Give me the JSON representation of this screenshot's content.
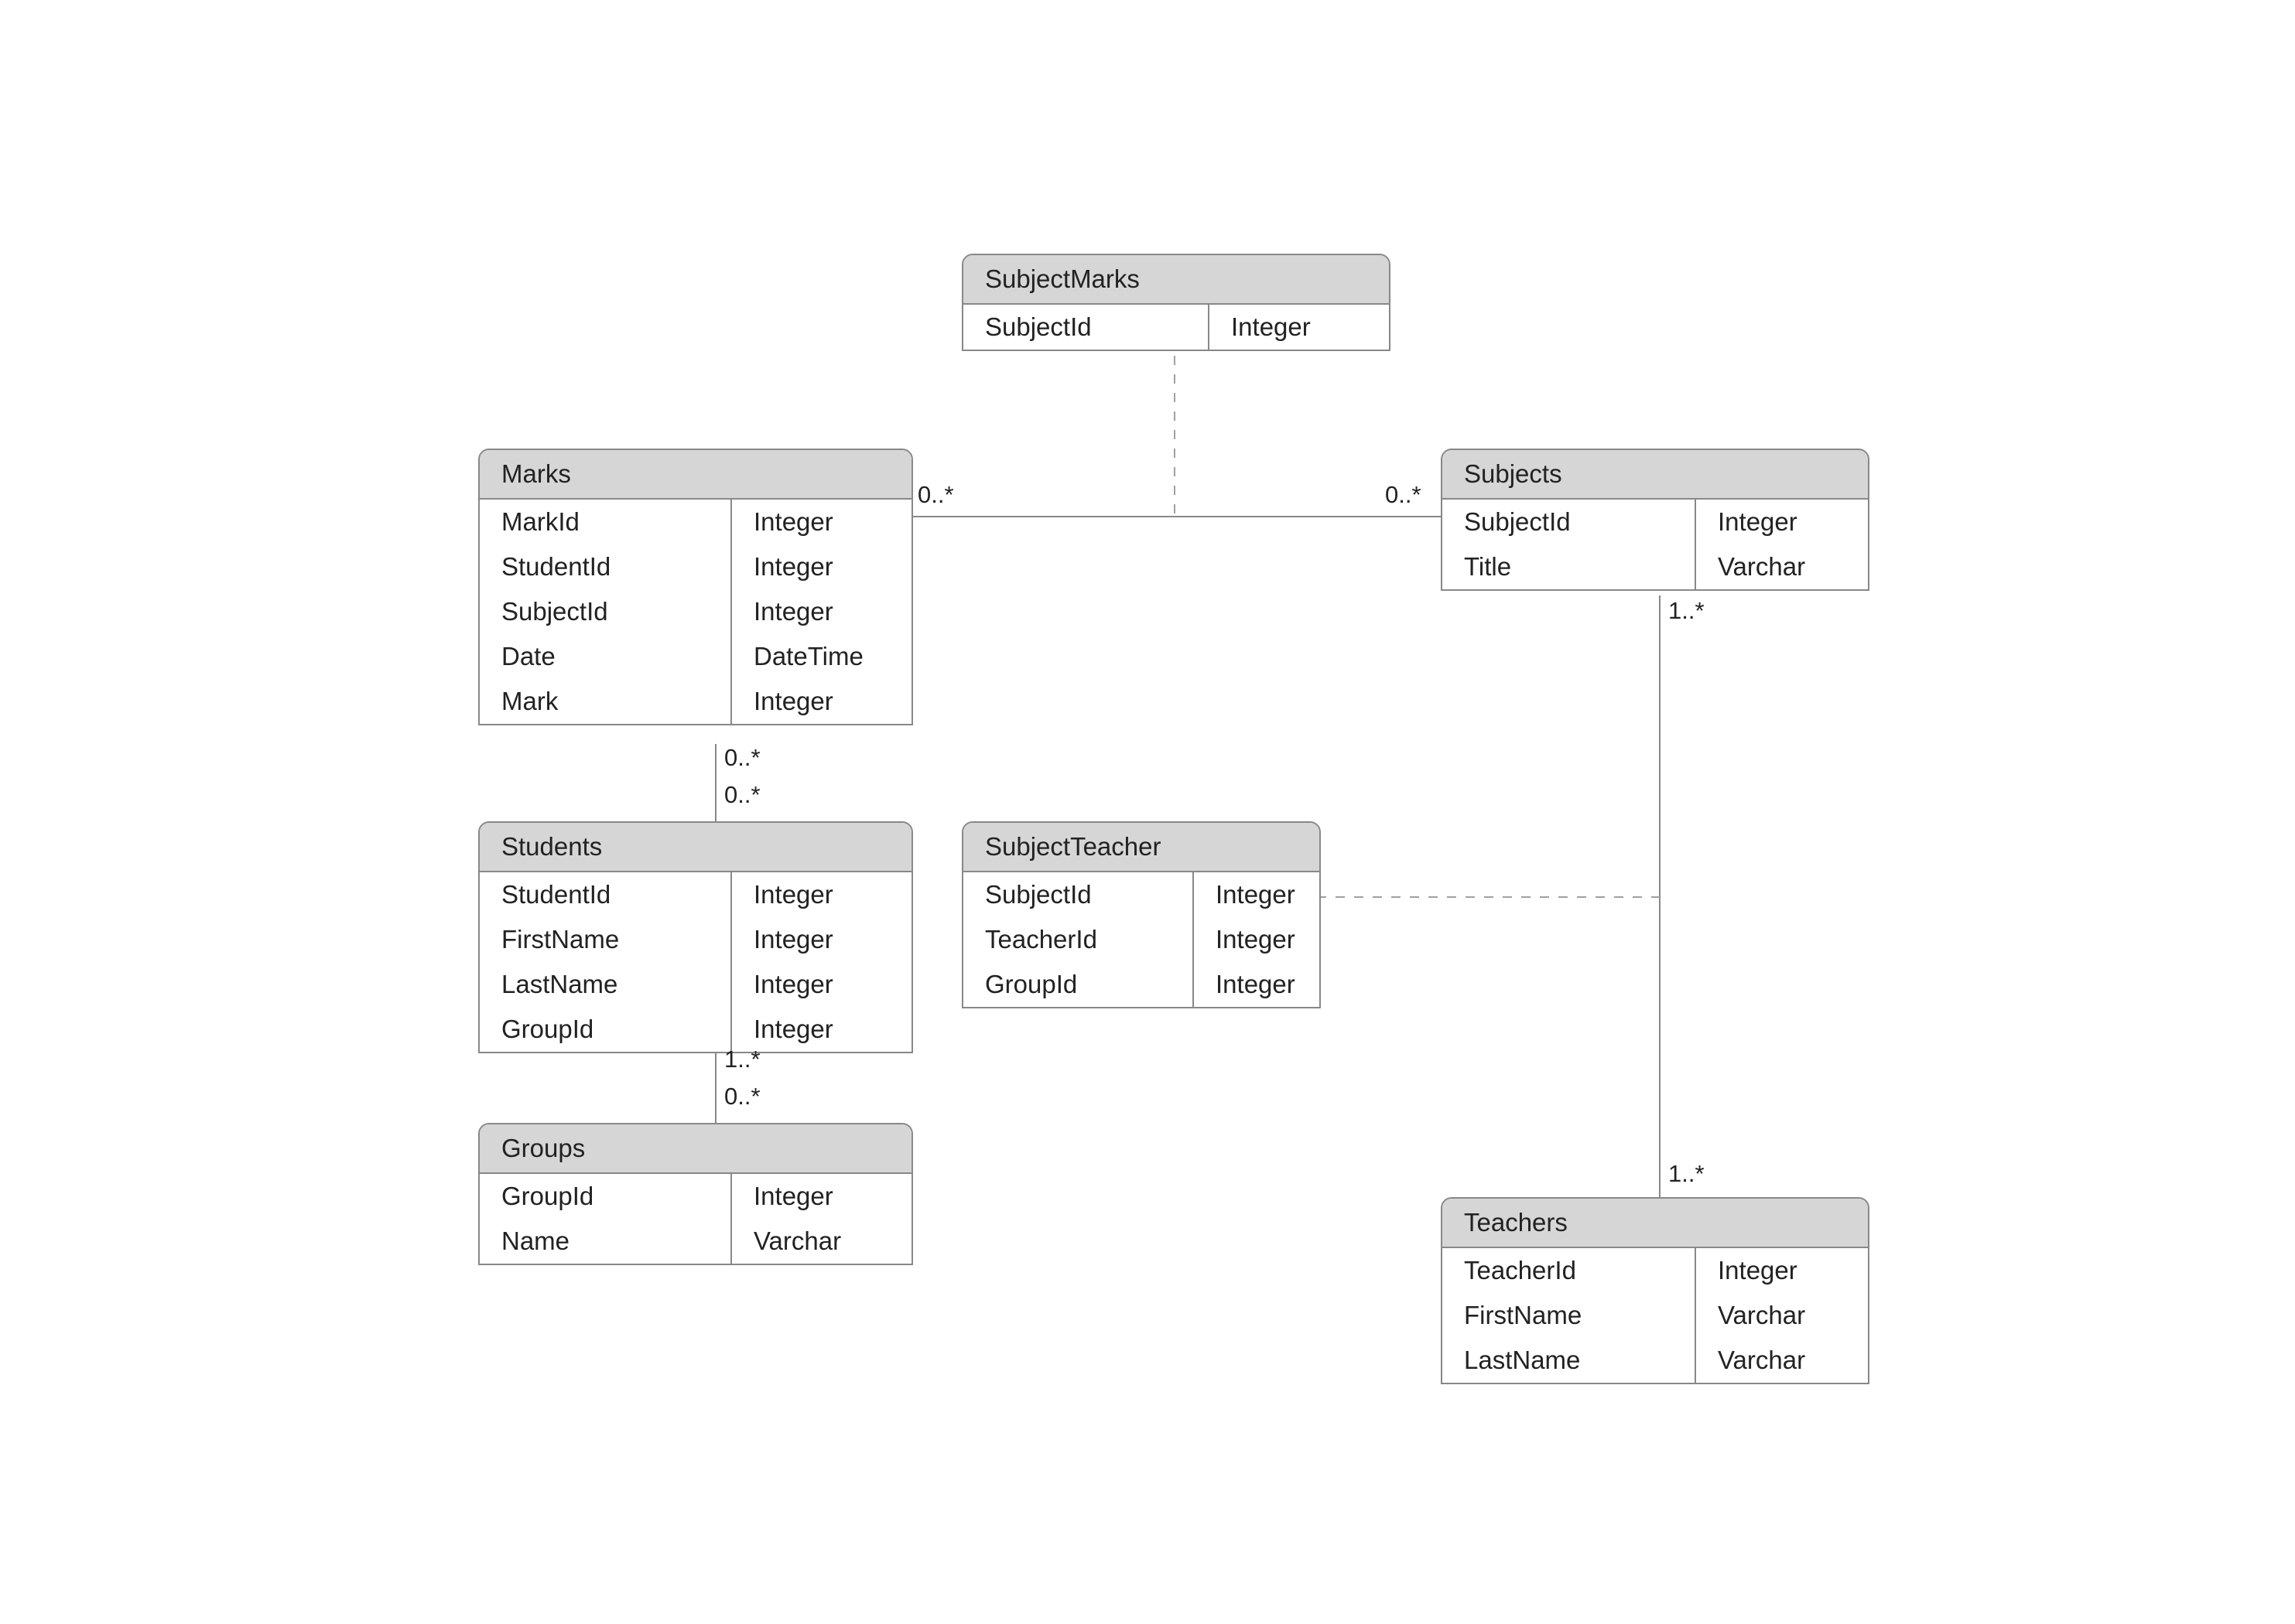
{
  "entities": {
    "subjectMarks": {
      "title": "SubjectMarks",
      "rows": [
        {
          "name": "SubjectId",
          "type": "Integer"
        }
      ]
    },
    "marks": {
      "title": "Marks",
      "rows": [
        {
          "name": "MarkId",
          "type": "Integer"
        },
        {
          "name": "StudentId",
          "type": "Integer"
        },
        {
          "name": "SubjectId",
          "type": "Integer"
        },
        {
          "name": "Date",
          "type": "DateTime"
        },
        {
          "name": "Mark",
          "type": "Integer"
        }
      ]
    },
    "subjects": {
      "title": "Subjects",
      "rows": [
        {
          "name": "SubjectId",
          "type": "Integer"
        },
        {
          "name": "Title",
          "type": "Varchar"
        }
      ]
    },
    "students": {
      "title": "Students",
      "rows": [
        {
          "name": "StudentId",
          "type": "Integer"
        },
        {
          "name": "FirstName",
          "type": "Integer"
        },
        {
          "name": "LastName",
          "type": "Integer"
        },
        {
          "name": "GroupId",
          "type": "Integer"
        }
      ]
    },
    "subjectTeacher": {
      "title": "SubjectTeacher",
      "rows": [
        {
          "name": "SubjectId",
          "type": "Integer"
        },
        {
          "name": "TeacherId",
          "type": "Integer"
        },
        {
          "name": "GroupId",
          "type": "Integer"
        }
      ]
    },
    "groups": {
      "title": "Groups",
      "rows": [
        {
          "name": "GroupId",
          "type": "Integer"
        },
        {
          "name": "Name",
          "type": "Varchar"
        }
      ]
    },
    "teachers": {
      "title": "Teachers",
      "rows": [
        {
          "name": "TeacherId",
          "type": "Integer"
        },
        {
          "name": "FirstName",
          "type": "Varchar"
        },
        {
          "name": "LastName",
          "type": "Varchar"
        }
      ]
    }
  },
  "labels": {
    "marks_subjects_left": "0..*",
    "marks_subjects_right": "0..*",
    "subjects_teachers_top": "1..*",
    "subjects_teachers_bottom": "1..*",
    "marks_students_top": "0..*",
    "marks_students_bottom": "0..*",
    "students_groups_top": "1..*",
    "students_groups_bottom": "0..*"
  }
}
